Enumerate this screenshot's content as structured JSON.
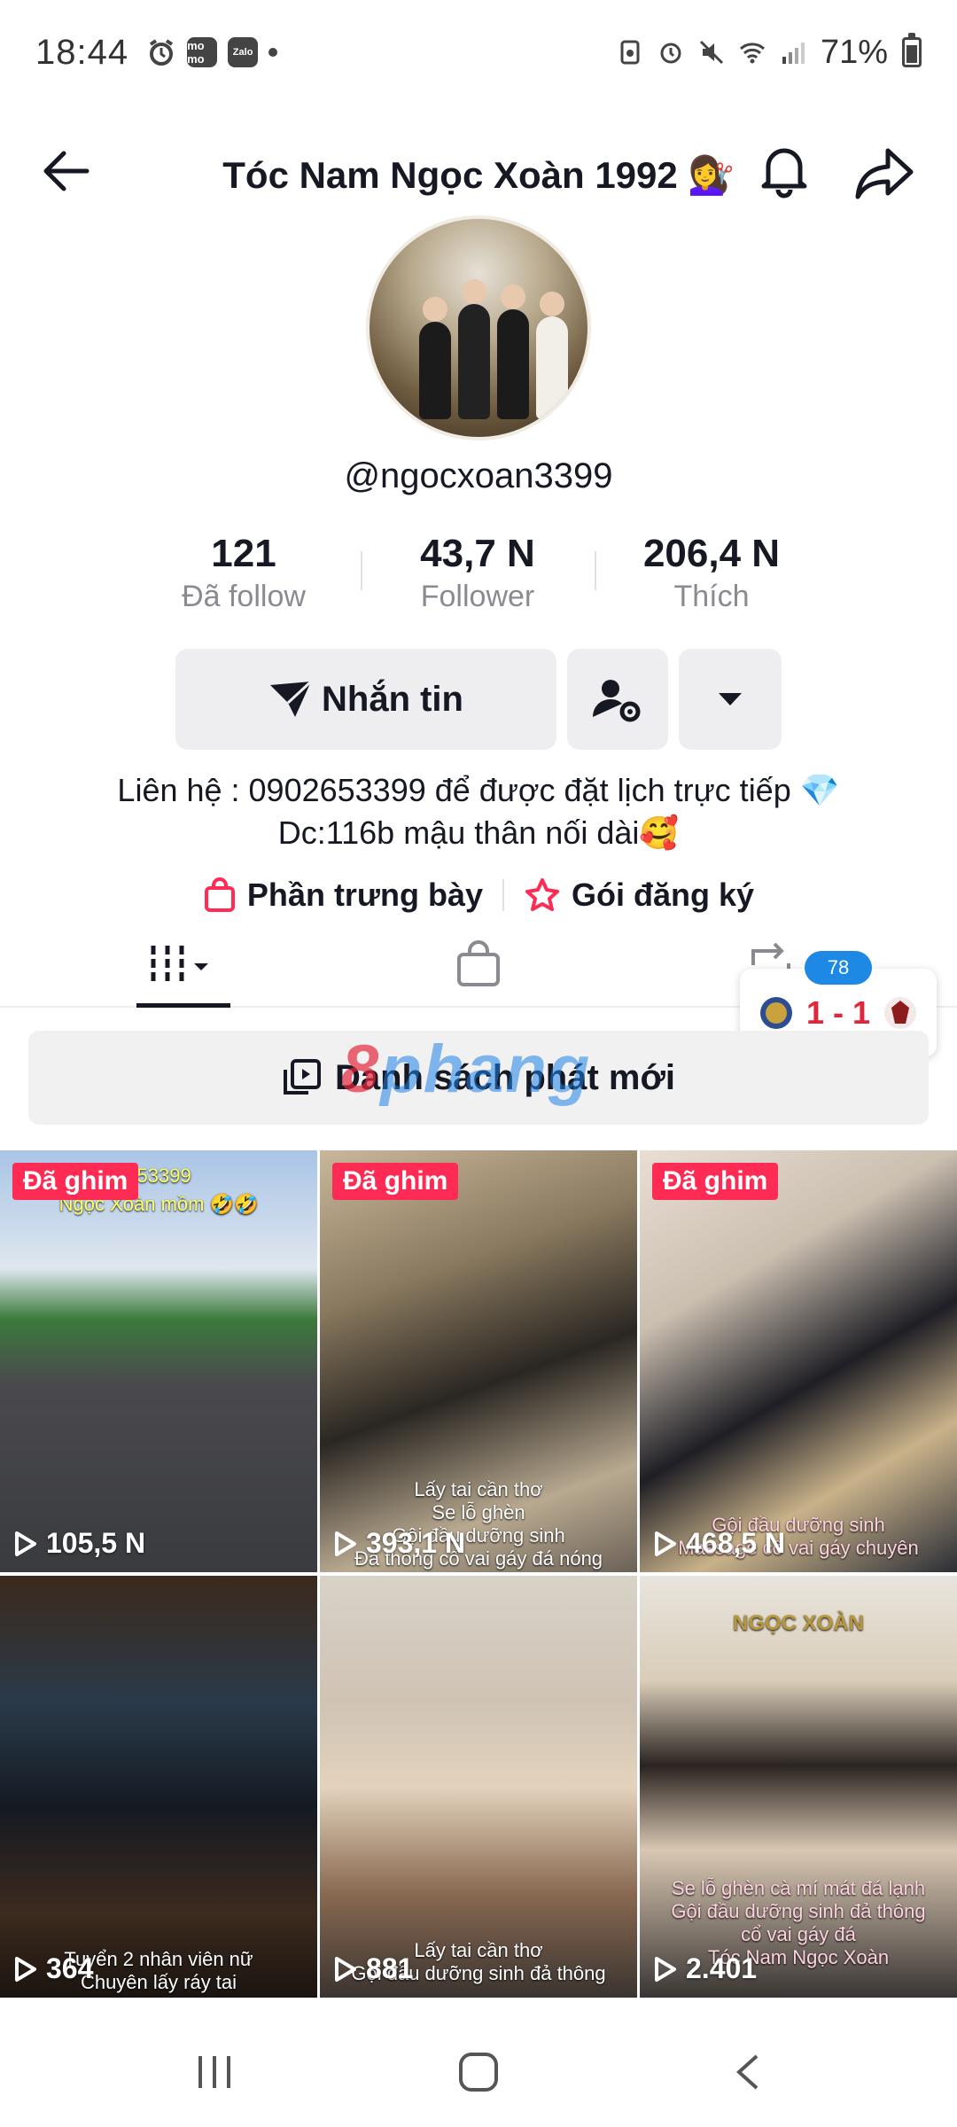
{
  "status_bar": {
    "time": "18:44",
    "left_icons": [
      "alarm-icon",
      "momo-icon",
      "zalo-icon"
    ],
    "momo_text": "mo mo",
    "zalo_text": "Zalo",
    "battery": "71%",
    "battery_level": 0.71
  },
  "header": {
    "title": "Tóc Nam Ngọc Xoàn 1992 💇‍♀️"
  },
  "profile": {
    "username": "@ngocxoan3399",
    "stats": [
      {
        "value": "121",
        "label": "Đã follow"
      },
      {
        "value": "43,7 N",
        "label": "Follower"
      },
      {
        "value": "206,4 N",
        "label": "Thích"
      }
    ],
    "message_button": "Nhắn tin",
    "bio_line1": "Liên hệ : 0902653399 để được đặt lịch trực tiếp 💎",
    "bio_line2": "Dc:116b mậu thân nối dài🥰",
    "link_showcase": "Phần trưng bày",
    "link_subscribe": "Gói đăng ký"
  },
  "score_widget": {
    "badge": "78",
    "score": "1 - 1"
  },
  "playlist": {
    "label": "Danh sách phát mới"
  },
  "watermark": {
    "text_a": "8",
    "text_b": "phang"
  },
  "videos": [
    {
      "pinned": "Đã ghim",
      "views": "105,5 N",
      "caption_top": "653399",
      "caption_top2": "Ngọc Xoàn mồm 🤣🤣",
      "caption_bottom": ""
    },
    {
      "pinned": "Đã ghim",
      "views": "393,1 N",
      "caption_top": "",
      "caption_top2": "",
      "caption_bottom": "Lấy tai cần thơ\nSe lỗ ghèn\nGội đầu dưỡng sinh\nĐả thông cổ vai gáy đá nóng"
    },
    {
      "pinned": "Đã ghim",
      "views": "468,5 N",
      "caption_top": "",
      "caption_top2": "",
      "caption_bottom": "Gội đầu dưỡng sinh\nMassage cổ vai gáy chuyên"
    },
    {
      "pinned": "",
      "views": "364",
      "caption_top": "",
      "caption_top2": "",
      "caption_bottom": "Tuyển 2 nhân viên nữ\nChuyên lấy ráy tai"
    },
    {
      "pinned": "",
      "views": "881",
      "caption_top": "",
      "caption_top2": "",
      "caption_bottom": "Lấy tai cần thơ\nGội đầu dưỡng sinh đả thông"
    },
    {
      "pinned": "",
      "views": "2.401",
      "caption_top": "NGỌC XOÀN",
      "caption_top2": "",
      "caption_bottom": "Se lỗ ghèn cà mí mát đá lạnh\nGội đầu dưỡng sinh đả thông\ncổ vai gáy đá\nTóc Nam Ngọc Xoàn"
    }
  ],
  "colors": {
    "accent": "#fe2c55",
    "button_bg": "#eeeef0",
    "muted_text": "#8a8b91",
    "score_red": "#e0263a",
    "badge_blue": "#1e88e5"
  }
}
